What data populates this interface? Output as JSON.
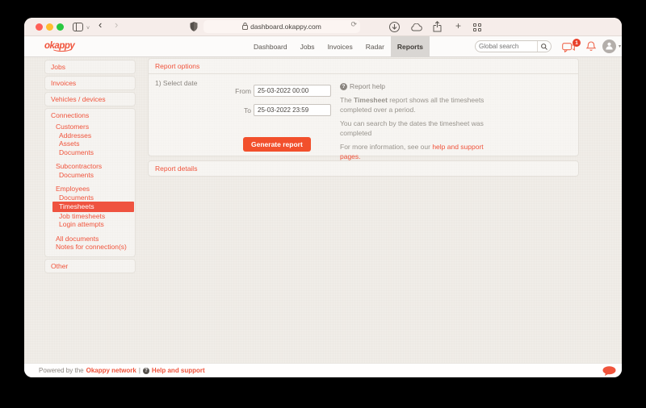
{
  "browser": {
    "url": "dashboard.okappy.com",
    "icons": {
      "plus": "+",
      "reload": "⟳",
      "back": "‹",
      "forward": "›",
      "chevron_down": "˅"
    }
  },
  "header": {
    "logo": "okappy",
    "nav": [
      "Dashboard",
      "Jobs",
      "Invoices",
      "Radar",
      "Reports"
    ],
    "search_placeholder": "Global search",
    "messages_badge": "1",
    "avatar_caret": "▾"
  },
  "sidebar": {
    "jobs": "Jobs",
    "invoices": "Invoices",
    "vehicles": "Vehicles / devices",
    "connections": "Connections",
    "customers": "Customers",
    "addresses": "Addresses",
    "assets": "Assets",
    "customers_documents": "Documents",
    "subcontractors": "Subcontractors",
    "subcontractors_documents": "Documents",
    "employees": "Employees",
    "employees_documents": "Documents",
    "timesheets": "Timesheets",
    "job_timesheets": "Job timesheets",
    "login_attempts": "Login attempts",
    "all_documents": "All documents",
    "notes": "Notes for connection(s)",
    "other": "Other"
  },
  "main": {
    "report_options_title": "Report options",
    "select_date_label": "1) Select date",
    "from_label": "From",
    "from_value": "25-03-2022 00:00",
    "to_label": "To",
    "to_value": "25-03-2022 23:59",
    "generate_button": "Generate report",
    "help": {
      "q": "?",
      "title": "Report help",
      "p1_pre": "The ",
      "p1_bold": "Timesheet",
      "p1_post": " report shows all the timesheets completed over a period.",
      "p2": "You can search by the dates the timesheet was completed",
      "p3_pre": "For more information, see our ",
      "p3_link": "help and support pages."
    },
    "report_details_title": "Report details"
  },
  "footer": {
    "pre": "Powered by the",
    "network_link": "Okappy network",
    "sep": "|",
    "q": "?",
    "help_link": "Help and support"
  },
  "colors": {
    "accent": "#f0533b",
    "button": "#f2502c",
    "active_tab_bg": "#d9d6d3",
    "badge": "#e8402a",
    "traffic_close": "#ff5f57",
    "traffic_min": "#febc2e",
    "traffic_max": "#28c840"
  }
}
